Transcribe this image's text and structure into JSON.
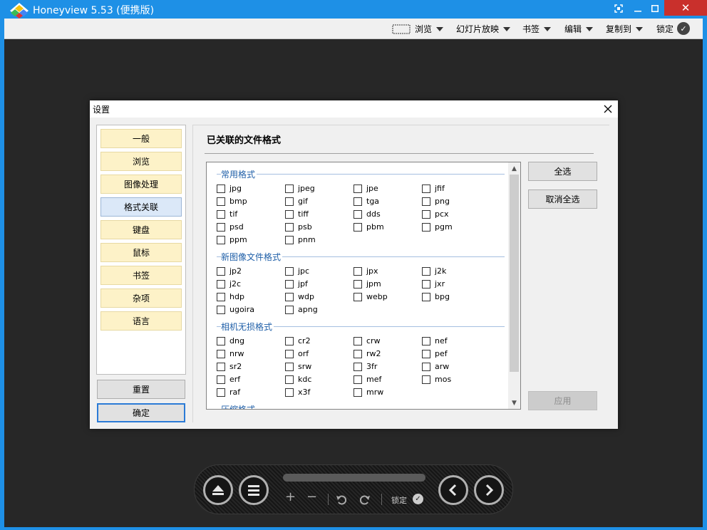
{
  "window": {
    "title": "Honeyview 5.53 (便携版)"
  },
  "toolbar": {
    "browse": "浏览",
    "slideshow": "幻灯片放映",
    "bookmark": "书签",
    "edit": "编辑",
    "copy_to": "复制到",
    "lock": "锁定"
  },
  "dialog": {
    "title": "设置",
    "nav": [
      "一般",
      "浏览",
      "图像处理",
      "格式关联",
      "键盘",
      "鼠标",
      "书签",
      "杂项",
      "语言"
    ],
    "active_nav": "格式关联",
    "reset": "重置",
    "ok": "确定",
    "content_title": "已关联的文件格式",
    "select_all": "全选",
    "deselect_all": "取消全选",
    "apply": "应用",
    "groups": [
      {
        "label": "常用格式",
        "items": [
          "jpg",
          "jpeg",
          "jpe",
          "jfif",
          "bmp",
          "gif",
          "tga",
          "png",
          "tif",
          "tiff",
          "dds",
          "pcx",
          "psd",
          "psb",
          "pbm",
          "pgm",
          "ppm",
          "pnm"
        ]
      },
      {
        "label": "新图像文件格式",
        "items": [
          "jp2",
          "jpc",
          "jpx",
          "j2k",
          "j2c",
          "jpf",
          "jpm",
          "jxr",
          "hdp",
          "wdp",
          "webp",
          "bpg",
          "ugoira",
          "apng"
        ]
      },
      {
        "label": "相机无损格式",
        "items": [
          "dng",
          "cr2",
          "crw",
          "nef",
          "nrw",
          "orf",
          "rw2",
          "pef",
          "sr2",
          "srw",
          "3fr",
          "arw",
          "erf",
          "kdc",
          "mef",
          "mos",
          "raf",
          "x3f",
          "mrw"
        ]
      },
      {
        "label": "压缩格式",
        "items": []
      }
    ]
  },
  "controls": {
    "lock": "锁定"
  }
}
